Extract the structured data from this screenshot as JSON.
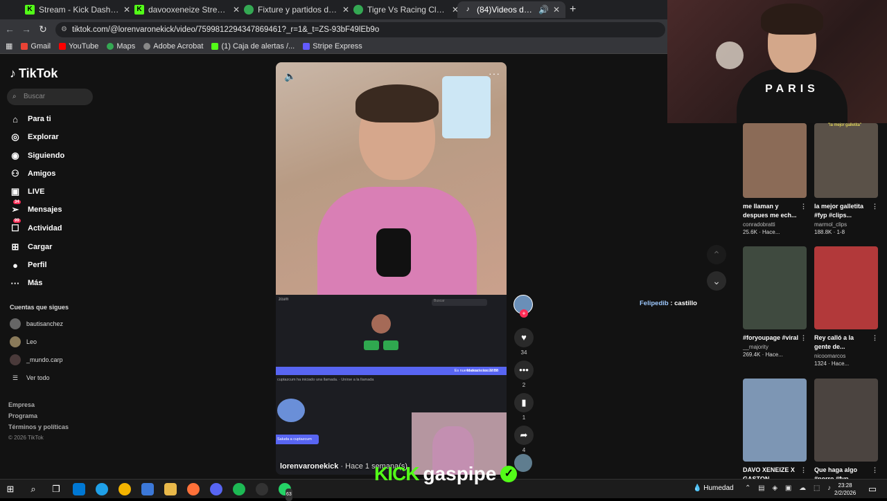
{
  "browser": {
    "tabs": [
      {
        "title": "Stream - Kick Dashboard",
        "icon": "kick-icon",
        "color": "#53fc18"
      },
      {
        "title": "davooxeneize Stream - Watch Live",
        "icon": "kick-icon",
        "color": "#53fc18"
      },
      {
        "title": "Fixture y partidos de 07-02-2026",
        "icon": "sports-icon",
        "color": "#34a853"
      },
      {
        "title": "Tigre Vs Racing Club - Alineaciones",
        "icon": "sports-icon",
        "color": "#34a853"
      },
      {
        "title": "(84)Videos de LORENVARONEKICK",
        "icon": "tiktok-icon",
        "color": "#ffffff",
        "active": true
      }
    ],
    "url": "tiktok.com/@lorenvaronekick/video/7599812294347869461?_r=1&_t=ZS-93bF49lEb9o",
    "bookmarks": [
      "Gmail",
      "YouTube",
      "Maps",
      "Adobe Acrobat",
      "(1) Caja de alertas /...",
      "Stripe Express"
    ]
  },
  "tiktok": {
    "logo": "TikTok",
    "search_placeholder": "Buscar",
    "nav": [
      {
        "label": "Para ti",
        "icon": "home-icon"
      },
      {
        "label": "Explorar",
        "icon": "compass-icon"
      },
      {
        "label": "Siguiendo",
        "icon": "following-icon"
      },
      {
        "label": "Amigos",
        "icon": "friends-icon"
      },
      {
        "label": "LIVE",
        "icon": "live-icon"
      },
      {
        "label": "Mensajes",
        "icon": "messages-icon",
        "badge": "34"
      },
      {
        "label": "Actividad",
        "icon": "activity-icon",
        "badge": "99"
      },
      {
        "label": "Cargar",
        "icon": "upload-icon"
      },
      {
        "label": "Perfil",
        "icon": "profile-icon"
      },
      {
        "label": "Más",
        "icon": "more-icon"
      }
    ],
    "following_title": "Cuentas que sigues",
    "following": [
      "bautisanchez",
      "Leo",
      "_mundo.carp"
    ],
    "see_all": "Ver todo",
    "footer": [
      "Empresa",
      "Programa",
      "Términos y políticas"
    ],
    "copyright": "© 2026 TikTok",
    "video": {
      "author": "lorenvaronekick",
      "time": "· Hace 1 semana(s)",
      "screen": {
        "search": "Buscar",
        "banner": "Es nuevo desde las 22:58",
        "banner_right": "Marcar como leído",
        "join_line": "cuptazcum ha iniciado una llamada. · Unirse a la llamada",
        "help_button": "Saluda a cuptazcum"
      }
    },
    "actions": {
      "likes": "34",
      "comments": "2",
      "saves": "1",
      "shares": "4"
    },
    "related": [
      {
        "title": "me llaman y despues me ech...",
        "author": "conradobratti",
        "stats": "25.6K · Hace...",
        "color": "#8b6b57"
      },
      {
        "title": "la mejor galletita #fyp #clips...",
        "author": "marmol_clips",
        "stats": "188.8K · 1-8",
        "color": "#5a5148"
      },
      {
        "title": "#foryoupage #viral",
        "author": "__majority",
        "stats": "269.4K · Hace...",
        "color": "#3f4a3f"
      },
      {
        "title": "Rey calló a la gente de...",
        "author": "nicoomarcos",
        "stats": "1324 · Hace...",
        "color": "#b2393a"
      },
      {
        "title": "DAVO XENEIZE X GASTON",
        "author": "",
        "stats": "",
        "color": "#7d96b4"
      },
      {
        "title": "Que haga algo #porro #fyp...",
        "author": "",
        "stats": "",
        "color": "#4b4440"
      }
    ]
  },
  "stream": {
    "chat_user": "Felipedib",
    "chat_text": " : castillo",
    "clip_label": "\"la mejor galletita\"",
    "kick_brand": "KICK",
    "streamer": "gaspipe",
    "shirt_text": "PARIS"
  },
  "taskbar": {
    "weather": "Humedad",
    "time": "23:28",
    "date": "2/2/2026",
    "whatsapp_badge": "63"
  }
}
